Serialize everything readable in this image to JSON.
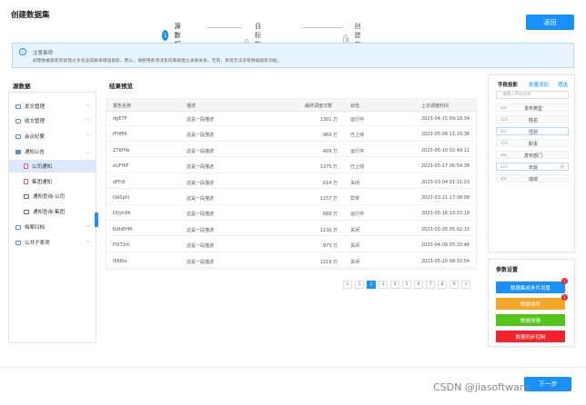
{
  "header": {
    "title": "创建数据集",
    "back_label": "返回",
    "steps": [
      {
        "num": "1",
        "label": "源数据"
      },
      {
        "num": "2",
        "label": "目标数据集"
      },
      {
        "num": "3",
        "label": "创建完成"
      }
    ]
  },
  "notice": {
    "title": "注意事项",
    "body": "如需数据投影的新建过多包含得表单增强投影，那么，请使用各项涉及的表单建立关联关系，否则，系统无法没有数据投影功能。"
  },
  "source": {
    "title": "源数据",
    "items": [
      {
        "label": "发文管理",
        "chev": "﹀"
      },
      {
        "label": "收文管理",
        "chev": "﹀"
      },
      {
        "label": "会议纪要",
        "chev": "﹀"
      },
      {
        "label": "通知公告",
        "chev": "︿"
      },
      {
        "label": "公司通知",
        "chev": ""
      },
      {
        "label": "集团通知",
        "chev": ""
      },
      {
        "label": "通知查询-公司",
        "chev": ""
      },
      {
        "label": "通知查询-集团",
        "chev": ""
      },
      {
        "label": "档案归档",
        "chev": "﹀"
      },
      {
        "label": "公共子表项",
        "chev": "﹀"
      }
    ]
  },
  "preview": {
    "title": "结果预览",
    "columns": [
      "报告名称",
      "描述",
      "最终调度次数",
      "状态",
      "上次调度时间"
    ],
    "rows": [
      [
        "dgE7F",
        "这是一段描述",
        "1301 万",
        "运行中",
        "2023-04-15 09:18:34"
      ],
      [
        "IFHfFA",
        "这是一段描述",
        "969 万",
        "已上线",
        "2023-05-08 11:29:36"
      ],
      [
        "Z7KHfe",
        "这是一段描述",
        "409 万",
        "运行中",
        "2023-06-10 02:49:11"
      ],
      [
        "eUFHlF",
        "这是一段描述",
        "1375 万",
        "已上线",
        "2023-05-17 06:54:38"
      ],
      [
        "dFFdI",
        "这是一段描述",
        "614 万",
        "关闭",
        "2023-03-04 01:11:23"
      ],
      [
        "OASphl",
        "这是一段描述",
        "1157 万",
        "异常",
        "2023-03-21 17:08:08"
      ],
      [
        "Drjyk9K",
        "这是一段描述",
        "689 万",
        "运行中",
        "2023-05-16 13:37:19"
      ],
      [
        "RdhEHM",
        "这是一段描述",
        "1130 万",
        "关闭",
        "2023-05-26 05:02:15"
      ],
      [
        "Fl972m",
        "这是一段描述",
        "973 万",
        "关闭",
        "2023-04-09 05:20:46"
      ],
      [
        "I66Eio",
        "这是一段描述",
        "1219 万",
        "关闭",
        "2023-05-20 08:32:54"
      ]
    ],
    "pages": [
      "<",
      "1",
      "2",
      "3",
      "4",
      "5",
      "6",
      "7",
      "8",
      "9",
      ">"
    ]
  },
  "fields": {
    "title": "字段投影",
    "batch_add": "批量添加",
    "filter": "筛选",
    "search_placeholder": "请输入字段名称",
    "items": [
      {
        "type": "abc",
        "name": "发布类型"
      },
      {
        "type": "123",
        "name": "姓名"
      },
      {
        "type": "abc",
        "name": "性别"
      },
      {
        "type": "123",
        "name": "职责"
      },
      {
        "type": "abc",
        "name": "发布部门"
      },
      {
        "type": "123",
        "name": "年龄"
      },
      {
        "type": "abc",
        "name": "成绩"
      }
    ]
  },
  "params": {
    "title": "参数设置",
    "buttons": [
      {
        "label": "数据集成条件设置",
        "color": "#1890ff"
      },
      {
        "label": "数据排序",
        "color": "#f5a623"
      },
      {
        "label": "数据排限",
        "color": "#52c41a"
      },
      {
        "label": "数据同步控制",
        "color": "#f5222d"
      }
    ],
    "badges": [
      "1",
      "1"
    ]
  },
  "footer": {
    "next_label": "下一步",
    "watermark": "CSDN @jiasoftware"
  }
}
